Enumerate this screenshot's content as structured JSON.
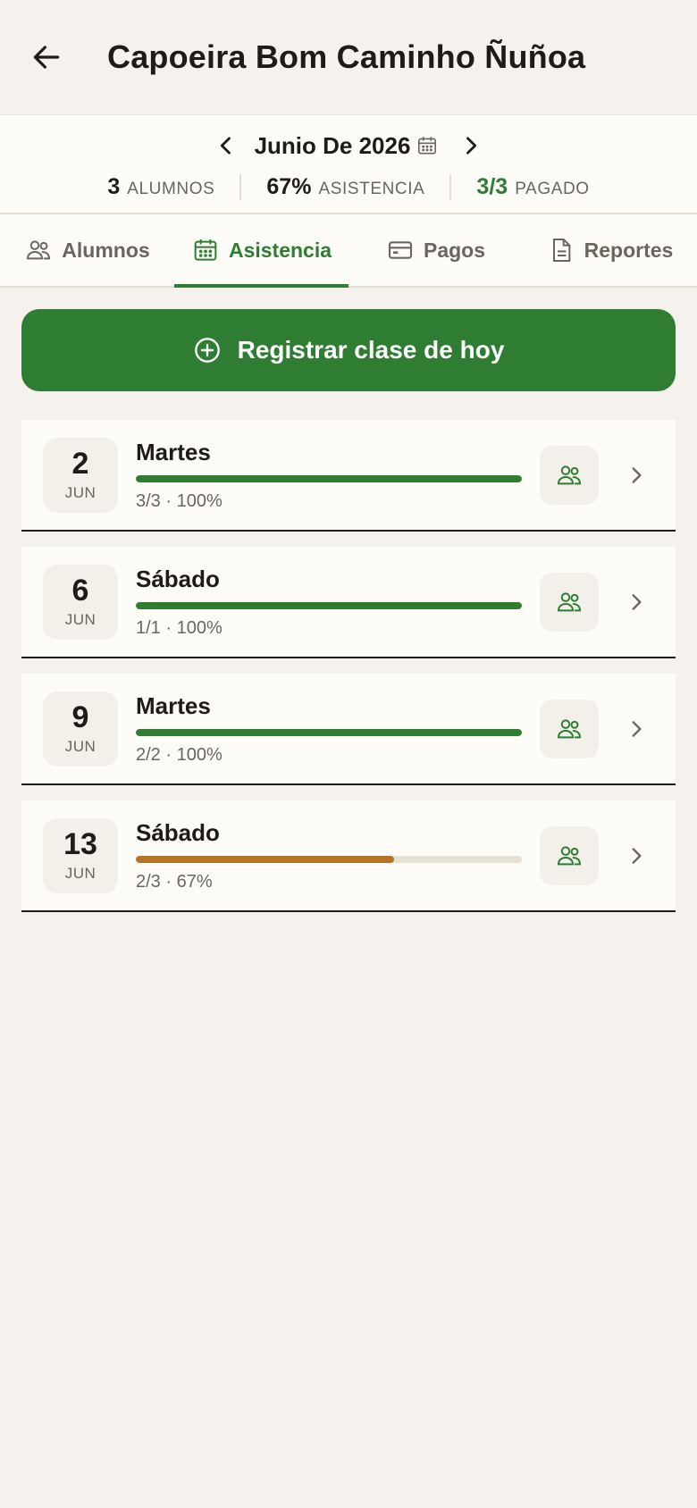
{
  "header": {
    "title": "Capoeira Bom Caminho Ñuñoa"
  },
  "month": {
    "label": "Junio De 2026"
  },
  "stats": [
    {
      "num": "3",
      "label": "ALUMNOS"
    },
    {
      "num": "67%",
      "label": "ASISTENCIA"
    },
    {
      "num": "3/3",
      "label": "PAGADO"
    }
  ],
  "tabs": [
    {
      "label": "Alumnos",
      "icon": "users-icon"
    },
    {
      "label": "Asistencia",
      "icon": "calendar-icon",
      "active": true
    },
    {
      "label": "Pagos",
      "icon": "credit-card-icon"
    },
    {
      "label": "Reportes",
      "icon": "document-icon"
    }
  ],
  "primary_button": {
    "label": "Registrar clase de hoy"
  },
  "classes": [
    {
      "day": "2",
      "month": "JUN",
      "weekday": "Martes",
      "meta": "3/3 · 100%",
      "attendance": 1.0,
      "color": "#2e7d32"
    },
    {
      "day": "6",
      "month": "JUN",
      "weekday": "Sábado",
      "meta": "1/1 · 100%",
      "attendance": 1.0,
      "color": "#2e7d32"
    },
    {
      "day": "9",
      "month": "JUN",
      "weekday": "Martes",
      "meta": "2/2 · 100%",
      "attendance": 1.0,
      "color": "#2e7d32"
    },
    {
      "day": "13",
      "month": "JUN",
      "weekday": "Sábado",
      "meta": "2/3 · 67%",
      "attendance": 0.67,
      "color": "#b87426"
    }
  ],
  "colors": {
    "accent": "#2e7d32",
    "warning": "#b87426",
    "background": "#f5f1ec",
    "surface": "#fdfcf7"
  }
}
